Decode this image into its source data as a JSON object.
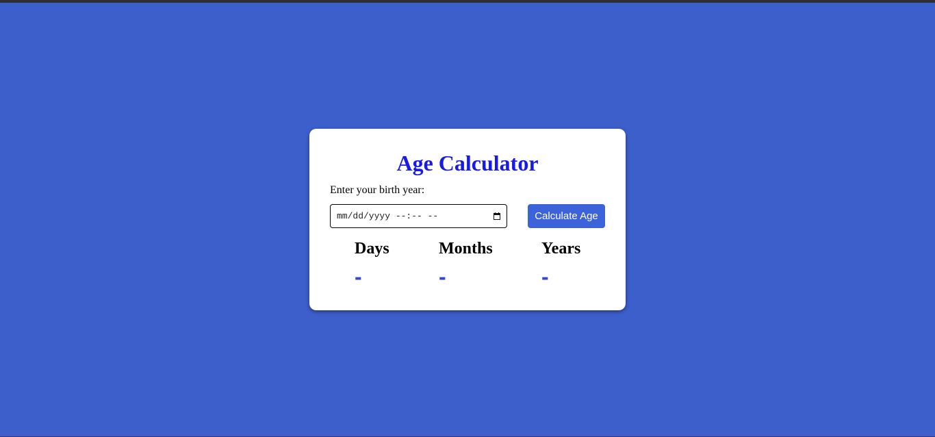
{
  "page": {
    "background_color": "#3d5fcc"
  },
  "card": {
    "title": "Age Calculator",
    "title_color": "#1a1ae6",
    "input_label": "Enter your birth year:",
    "date_input": {
      "placeholder": "mm/dd/yyyy --:-- --",
      "value": ""
    },
    "button": {
      "label": "Calculate Age",
      "color": "#3d63db"
    },
    "results": [
      {
        "label": "Days",
        "value": "-"
      },
      {
        "label": "Months",
        "value": "-"
      },
      {
        "label": "Years",
        "value": "-"
      }
    ],
    "result_value_color": "#3a45cc"
  },
  "icons": {
    "date_picker": "calendar-icon"
  }
}
